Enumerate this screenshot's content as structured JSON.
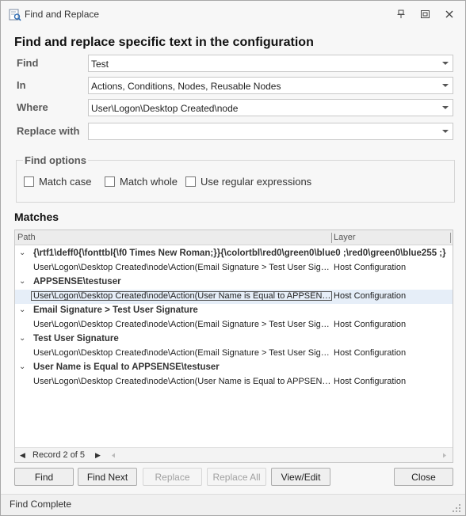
{
  "window": {
    "title": "Find and Replace"
  },
  "heading": "Find and replace specific text in the configuration",
  "fields": {
    "find": {
      "label": "Find",
      "value": "Test"
    },
    "in": {
      "label": "In",
      "value": "Actions, Conditions, Nodes, Reusable Nodes"
    },
    "where": {
      "label": "Where",
      "value": "User\\Logon\\Desktop Created\\node"
    },
    "replace": {
      "label": "Replace with",
      "value": ""
    }
  },
  "find_options": {
    "title": "Find options",
    "match_case": "Match case",
    "match_whole": "Match whole",
    "regex": "Use regular expressions"
  },
  "matches": {
    "title": "Matches",
    "columns": {
      "path": "Path",
      "layer": "Layer"
    },
    "groups": [
      {
        "text": "{\\rtf1\\deff0{\\fonttbl{\\f0 Times New Roman;}}{\\colortbl\\red0\\green0\\blue0 ;\\red0\\green0\\blue255 ;}",
        "row": {
          "path": "User\\Logon\\Desktop Created\\node\\Action(Email Signature > Test User Signature)",
          "layer": "Host Configuration"
        }
      },
      {
        "text": "APPSENSE\\testuser",
        "row": {
          "path": "User\\Logon\\Desktop Created\\node\\Action(User Name is Equal to APPSENSE\\testuser)",
          "layer": "Host Configuration"
        }
      },
      {
        "text": "Email Signature > Test User Signature",
        "row": {
          "path": "User\\Logon\\Desktop Created\\node\\Action(Email Signature > Test User Signature)",
          "layer": "Host Configuration"
        }
      },
      {
        "text": "Test User Signature",
        "row": {
          "path": "User\\Logon\\Desktop Created\\node\\Action(Email Signature > Test User Signature)",
          "layer": "Host Configuration"
        }
      },
      {
        "text": "User Name is Equal to APPSENSE\\testuser",
        "row": {
          "path": "User\\Logon\\Desktop Created\\node\\Action(User Name is Equal to APPSENSE\\testuser)",
          "layer": "Host Configuration"
        }
      }
    ],
    "record_label": "Record 2 of 5"
  },
  "buttons": {
    "find": "Find",
    "find_next": "Find Next",
    "replace": "Replace",
    "replace_all": "Replace All",
    "view_edit": "View/Edit",
    "close": "Close"
  },
  "status": "Find Complete",
  "colors": {
    "selected_row": "#e6eef8",
    "window_bg": "#f7f7f7"
  },
  "icons": [
    "find-replace-app-icon",
    "pin-icon",
    "restore-icon",
    "close-icon",
    "chevron-down-icon",
    "nav-prev-icon",
    "nav-next-icon",
    "size-grip-icon"
  ]
}
